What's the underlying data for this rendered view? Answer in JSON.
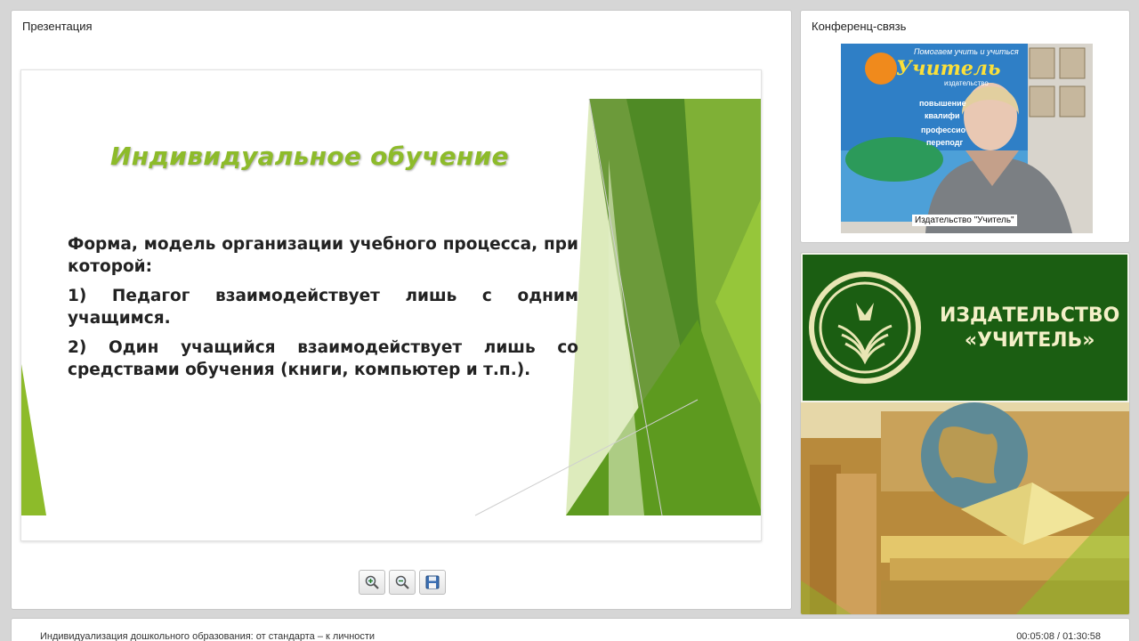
{
  "presentation": {
    "title": "Презентация",
    "slide": {
      "heading": "Индивидуальное обучение",
      "paragraphs": [
        "Форма, модель организации учебного процесса, при которой:",
        "1) Педагог взаимодействует лишь с одним учащимся.",
        "2) Один учащийся взаимодействует лишь со средствами обучения (книги, компьютер и т.п.)."
      ],
      "accent_color": "#8dbb2a"
    },
    "toolbar": {
      "zoom_in_icon": "zoom-in-icon",
      "zoom_out_icon": "zoom-out-icon",
      "save_icon": "floppy-disk-icon"
    }
  },
  "conference": {
    "title": "Конференц-связь",
    "video": {
      "banner_lines": [
        "Помогаем учить и учиться",
        "Учитель",
        "издательство",
        "повышение",
        "квалифи",
        "профессио",
        "переподг"
      ],
      "speaker_label": "Издательство \"Учитель\""
    }
  },
  "banner": {
    "line1": "ИЗДАТЕЛЬСТВО",
    "line2": "«УЧИТЕЛЬ»",
    "color": "#1b5e12"
  },
  "footer": {
    "webinar_title": "Индивидуализация дошкольного образования: от стандарта – к личности",
    "time": "00:05:08 / 01:30:58"
  }
}
